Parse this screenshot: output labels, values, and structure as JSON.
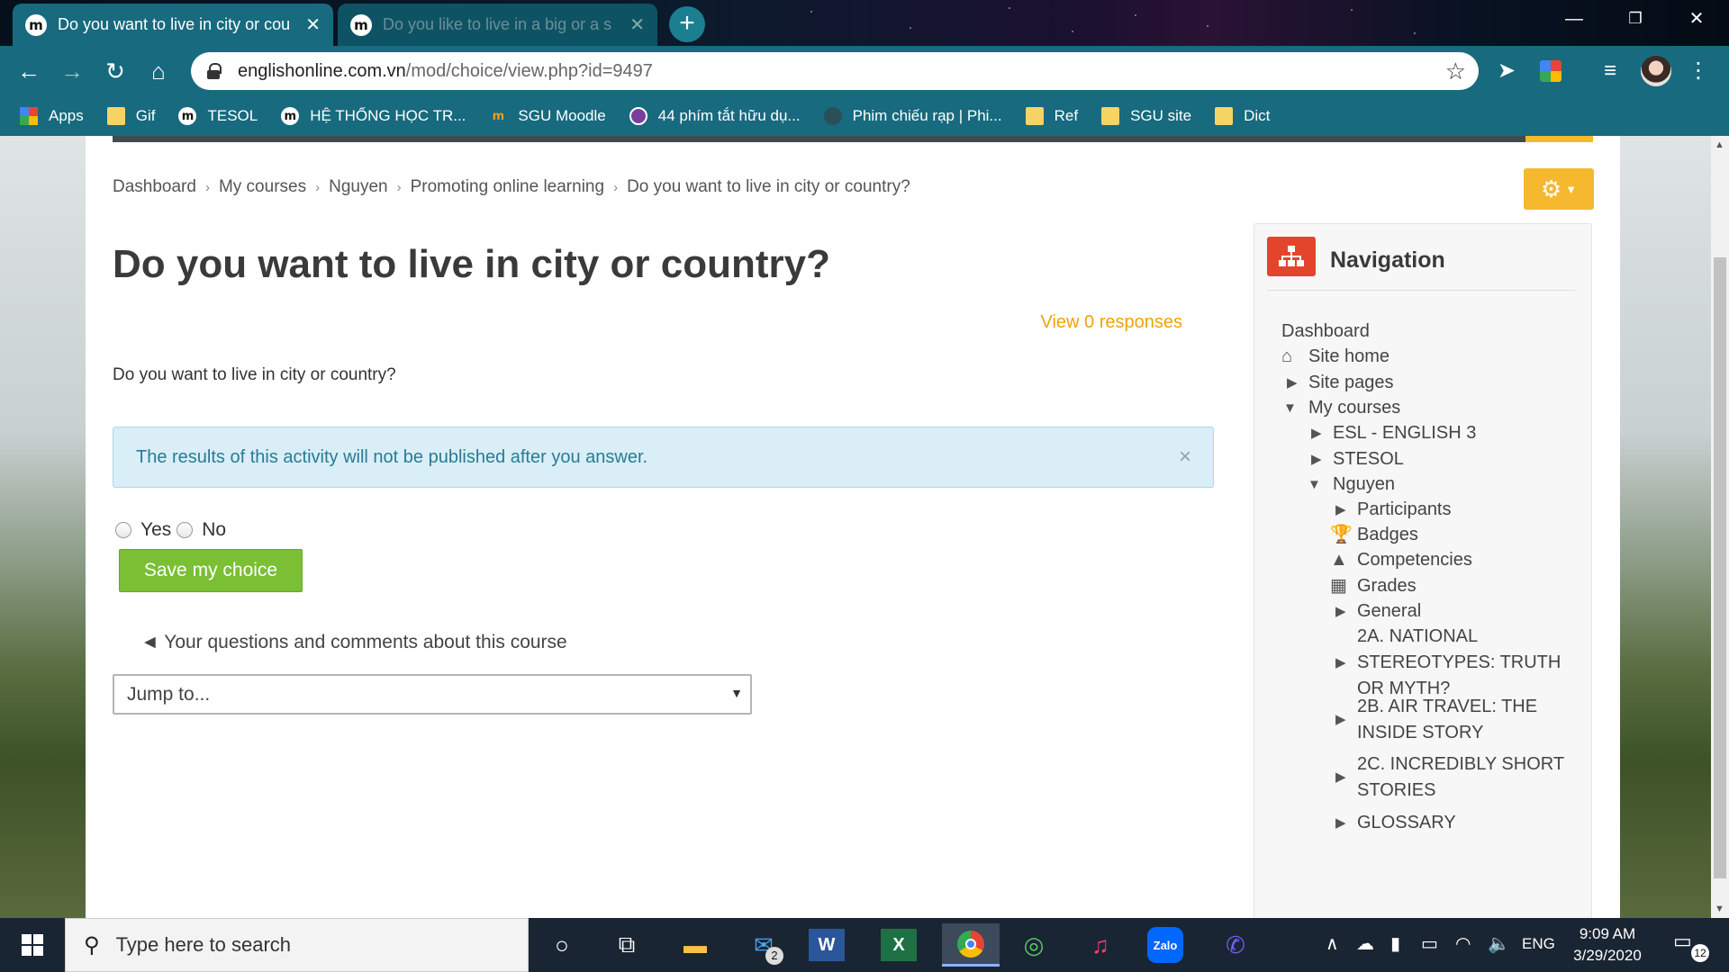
{
  "browser": {
    "tabs": [
      {
        "title": "Do you want to live in city or cou",
        "favicon": "m"
      },
      {
        "title": "Do you like to live in a big or a s",
        "favicon": "m"
      }
    ],
    "url_host": "englishonline.com.vn",
    "url_path": "/mod/choice/view.php?id=9497",
    "bookmarks": [
      {
        "label": "Apps",
        "icon": "apps-grid"
      },
      {
        "label": "Gif",
        "icon": "folder"
      },
      {
        "label": "TESOL",
        "icon": "moodle"
      },
      {
        "label": "HỆ THỐNG HỌC TR...",
        "icon": "moodle"
      },
      {
        "label": "SGU Moodle",
        "icon": "moodle-orange"
      },
      {
        "label": "44 phím tắt hữu dụ...",
        "icon": "circle-purple"
      },
      {
        "label": "Phim chiếu rạp | Phi...",
        "icon": "circle-gray"
      },
      {
        "label": "Ref",
        "icon": "folder"
      },
      {
        "label": "SGU site",
        "icon": "folder"
      },
      {
        "label": "Dict",
        "icon": "folder"
      }
    ]
  },
  "breadcrumb": [
    "Dashboard",
    "My courses",
    "Nguyen",
    "Promoting online learning",
    "Do you want to live in city or country?"
  ],
  "page": {
    "title": "Do you want to live in city or country?",
    "view_responses": "View 0 responses",
    "intro": "Do you want to live in city or country?",
    "alert": "The results of this activity will not be published after you answer.",
    "alert_close": "×",
    "choices": [
      "Yes",
      "No"
    ],
    "save_label": "Save my choice",
    "prev_activity": "◄ Your questions and comments about this course",
    "jump_placeholder": "Jump to..."
  },
  "navigation": {
    "title": "Navigation",
    "items": [
      {
        "label": "Dashboard",
        "level": 0,
        "icon": "none"
      },
      {
        "label": "Site home",
        "level": 0,
        "icon": "home-icon"
      },
      {
        "label": "Site pages",
        "level": 0,
        "icon": "collapsed"
      },
      {
        "label": "My courses",
        "level": 0,
        "icon": "expanded"
      },
      {
        "label": "ESL - ENGLISH 3",
        "level": 1,
        "icon": "collapsed"
      },
      {
        "label": "STESOL",
        "level": 1,
        "icon": "collapsed"
      },
      {
        "label": "Nguyen",
        "level": 1,
        "icon": "expanded"
      },
      {
        "label": "Participants",
        "level": 2,
        "icon": "collapsed"
      },
      {
        "label": "Badges",
        "level": 2,
        "icon": "trophy-icon"
      },
      {
        "label": "Competencies",
        "level": 2,
        "icon": "triangle-icon"
      },
      {
        "label": "Grades",
        "level": 2,
        "icon": "table-icon"
      },
      {
        "label": "General",
        "level": 2,
        "icon": "collapsed"
      },
      {
        "label": "2A. NATIONAL STEREOTYPES: TRUTH OR MYTH?",
        "level": 2,
        "icon": "collapsed"
      },
      {
        "label": "2B. AIR TRAVEL: THE INSIDE STORY",
        "level": 2,
        "icon": "collapsed"
      },
      {
        "label": "2C. INCREDIBLY SHORT STORIES",
        "level": 2,
        "icon": "collapsed"
      },
      {
        "label": "GLOSSARY",
        "level": 2,
        "icon": "collapsed"
      }
    ]
  },
  "taskbar": {
    "search_placeholder": "Type here to search",
    "mail_badge": "2",
    "language": "ENG",
    "time": "9:09 AM",
    "date": "3/29/2020",
    "notification_count": "12"
  },
  "colors": {
    "browser_teal": "#186a7e",
    "moodle_orange": "#f5b82e",
    "save_green": "#7bbf34",
    "nav_icon_red": "#e2452b",
    "alert_bg": "#d9eef6"
  }
}
